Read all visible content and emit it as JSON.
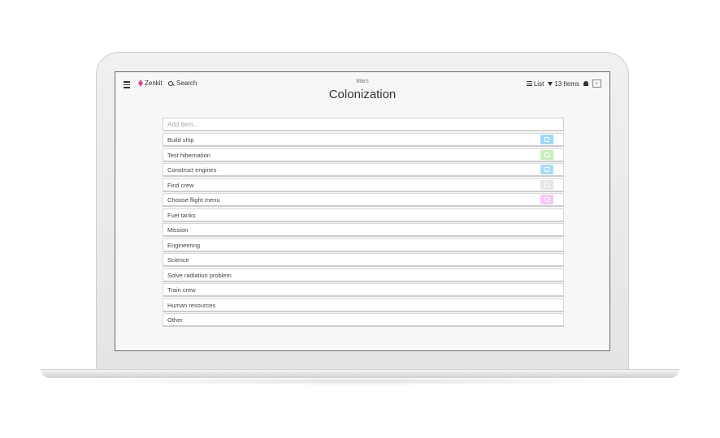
{
  "header": {
    "app_name": "Zenkit",
    "search_label": "Search",
    "subtitle": "Mars",
    "title": "Colonization",
    "view_label": "List",
    "filter_label": "13 Items",
    "avatar_text": "S"
  },
  "add_item": {
    "placeholder": "Add item..."
  },
  "items": [
    {
      "label": "Build ship",
      "badge_color": "#9fd8f7",
      "badge_icon": "ship-icon"
    },
    {
      "label": "Test hibernation",
      "badge_color": "#c9eec0",
      "badge_icon": "plant-icon"
    },
    {
      "label": "Construct engines",
      "badge_color": "#a9dcf7",
      "badge_icon": "engine-icon"
    },
    {
      "label": "Find crew",
      "badge_color": "#e6e6e6",
      "badge_icon": "trophy-icon"
    },
    {
      "label": "Choose flight menu",
      "badge_color": "#f6c8f3",
      "badge_icon": "menu-card-icon"
    },
    {
      "label": "Fuel tanks"
    },
    {
      "label": "Mission"
    },
    {
      "label": "Engineering"
    },
    {
      "label": "Science"
    },
    {
      "label": "Solve radiation problem"
    },
    {
      "label": "Train crew"
    },
    {
      "label": "Human resources"
    },
    {
      "label": "Other"
    }
  ],
  "colors": {
    "logo_accent": "#e0449b",
    "bezel": "#e6e6e6"
  }
}
